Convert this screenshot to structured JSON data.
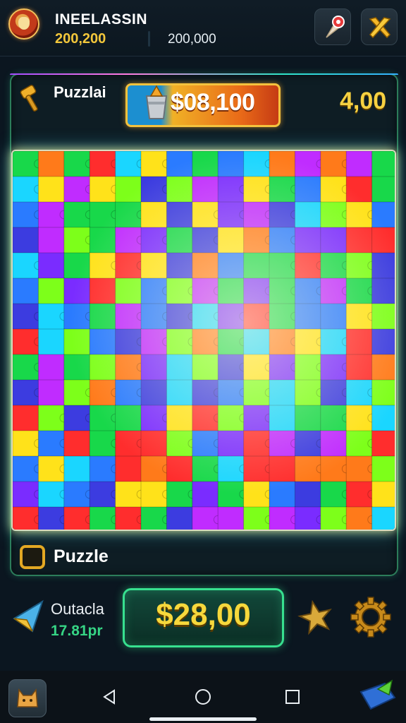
{
  "header": {
    "player_name": "INEELASSIN",
    "player_coins": "200,200",
    "player_score": "200,000"
  },
  "panel": {
    "title": "Puzzlai",
    "cash_value": "$08,100",
    "multiplier": "4,00",
    "footer_label": "Puzzle"
  },
  "bottom": {
    "outside_label": "Outacla",
    "outside_rate": "17.81pr",
    "buy_label": "$28,00"
  },
  "colors": {
    "accent_green": "#37e08f",
    "gold": "#f6d83c",
    "board_pieces": [
      "#ff2d2d",
      "#ff7a1a",
      "#ffe21a",
      "#7dff1a",
      "#18d84a",
      "#1ad6ff",
      "#2a7bff",
      "#3c3ce0",
      "#7a2cff",
      "#c02cff"
    ]
  },
  "icons": {
    "pin": "map-pin-icon",
    "tools": "crossed-tools-icon",
    "hammer": "hammer-icon",
    "bucket": "bucket-icon",
    "kite": "kite-icon",
    "star": "star-icon",
    "gear": "gear-icon"
  }
}
